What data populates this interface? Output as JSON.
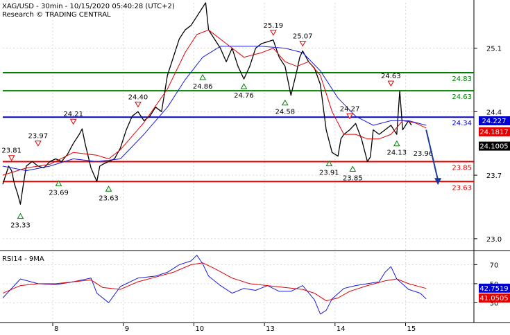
{
  "header": {
    "instrument_line": "XAG/USD - 30min - 10/15/2020 05:40:28 (UTC+2)",
    "research_line": "Research © TRADING CENTRAL"
  },
  "colors": {
    "price": "#000000",
    "ma_fast": "#e00000",
    "ma_slow": "#1c1cd8",
    "resistance_green": "#008000",
    "support_red": "#e00000",
    "pivot_blue": "#0000cc",
    "marker_red": "#e00000",
    "marker_green": "#008000",
    "projection_arrow": "#1a3a9c",
    "rsi_line": "#1c1cd8",
    "rsi_ma": "#e00000"
  },
  "chart_data": [
    {
      "type": "line",
      "panel": "price",
      "ylim": [
        22.9,
        25.6
      ],
      "y_ticks": [
        23.0,
        23.7,
        24.4,
        25.1
      ],
      "x_ticks": [
        "8",
        "9",
        "10",
        "13",
        "14",
        "15"
      ],
      "x_tick_positions": [
        17,
        41,
        65,
        89,
        113,
        137
      ],
      "x_range": [
        0,
        160
      ],
      "series": [
        {
          "role": "price",
          "x": [
            0,
            2,
            3,
            4,
            5,
            6,
            7,
            8,
            10,
            12,
            14,
            16,
            18,
            20,
            22,
            24,
            26,
            27,
            28,
            30,
            32,
            33,
            34,
            36,
            38,
            40,
            42,
            44,
            46,
            48,
            50,
            52,
            54,
            56,
            58,
            60,
            62,
            64,
            66,
            68,
            69,
            70,
            72,
            74,
            76,
            78,
            80,
            82,
            84,
            86,
            88,
            90,
            92,
            94,
            96,
            98,
            100,
            101,
            102,
            104,
            106,
            108,
            110,
            112,
            114,
            115,
            116,
            118,
            120,
            122,
            124,
            125,
            126,
            128,
            130,
            132,
            134,
            135,
            136,
            138,
            139
          ],
          "values": [
            23.6,
            23.8,
            23.75,
            23.6,
            23.5,
            23.38,
            23.6,
            23.8,
            23.85,
            23.8,
            23.78,
            23.85,
            23.88,
            23.85,
            23.93,
            24.05,
            24.15,
            24.21,
            24.05,
            23.78,
            23.63,
            23.8,
            23.82,
            23.85,
            23.88,
            24.0,
            24.2,
            24.35,
            24.4,
            24.3,
            24.35,
            24.45,
            24.4,
            24.8,
            25.0,
            25.2,
            25.3,
            25.35,
            25.45,
            25.55,
            25.6,
            25.3,
            25.2,
            25.1,
            24.95,
            25.1,
            24.9,
            24.76,
            24.9,
            25.1,
            25.15,
            25.17,
            25.19,
            25.0,
            24.9,
            24.58,
            24.85,
            25.0,
            25.07,
            24.95,
            24.88,
            24.7,
            24.2,
            23.95,
            23.91,
            24.1,
            24.15,
            24.2,
            24.27,
            24.1,
            23.85,
            23.9,
            24.2,
            24.15,
            24.2,
            24.25,
            24.15,
            24.63,
            24.2,
            24.3,
            24.25
          ],
          "name": ""
        },
        {
          "role": "fast_ma",
          "x": [
            0,
            8,
            16,
            24,
            32,
            36,
            40,
            48,
            56,
            62,
            66,
            70,
            76,
            82,
            88,
            92,
            96,
            100,
            104,
            108,
            112,
            116,
            120,
            124,
            128,
            132,
            136,
            140,
            144
          ],
          "values": [
            23.7,
            23.78,
            23.82,
            23.95,
            23.92,
            23.88,
            23.98,
            24.28,
            24.65,
            25.05,
            25.25,
            25.3,
            25.15,
            25.0,
            25.05,
            25.1,
            24.95,
            24.9,
            24.95,
            24.8,
            24.4,
            24.15,
            24.15,
            24.1,
            24.1,
            24.15,
            24.3,
            24.28,
            24.22
          ],
          "name": ""
        },
        {
          "role": "slow_ma",
          "x": [
            0,
            8,
            16,
            24,
            32,
            40,
            48,
            56,
            62,
            68,
            74,
            80,
            88,
            96,
            102,
            108,
            114,
            120,
            126,
            132,
            138,
            144
          ],
          "values": [
            23.8,
            23.75,
            23.8,
            23.88,
            23.85,
            23.88,
            24.15,
            24.45,
            24.75,
            25.0,
            25.12,
            25.12,
            25.12,
            25.1,
            25.05,
            24.85,
            24.55,
            24.35,
            24.25,
            24.3,
            24.3,
            24.25
          ]
        }
      ],
      "levels": [
        {
          "value": 24.83,
          "label": "24.83",
          "color": "#008000"
        },
        {
          "value": 24.63,
          "label": "24.63",
          "color": "#008000"
        },
        {
          "value": 24.34,
          "label": "24.34",
          "color": "#0000cc"
        },
        {
          "value": 23.85,
          "label": "23.85",
          "color": "#e00000"
        },
        {
          "value": 23.63,
          "label": "23.63",
          "color": "#e00000"
        }
      ],
      "markers": [
        {
          "x": 3,
          "value": 23.81,
          "label": "23.81",
          "dir": "down"
        },
        {
          "x": 12,
          "value": 23.97,
          "label": "23.97",
          "dir": "down"
        },
        {
          "x": 24,
          "value": 24.21,
          "label": "24.21",
          "dir": "down"
        },
        {
          "x": 46,
          "value": 24.4,
          "label": "24.40",
          "dir": "down"
        },
        {
          "x": 69,
          "value": 25.6,
          "label": "",
          "dir": "down"
        },
        {
          "x": 92,
          "value": 25.19,
          "label": "25.19",
          "dir": "down"
        },
        {
          "x": 102,
          "value": 25.07,
          "label": "25.07",
          "dir": "down"
        },
        {
          "x": 118,
          "value": 24.27,
          "label": "24.27",
          "dir": "down"
        },
        {
          "x": 132,
          "value": 24.63,
          "label": "24.63",
          "dir": "down"
        },
        {
          "x": 6,
          "value": 23.33,
          "label": "23.33",
          "dir": "up"
        },
        {
          "x": 19,
          "value": 23.69,
          "label": "23.69",
          "dir": "up"
        },
        {
          "x": 36,
          "value": 23.63,
          "label": "23.63",
          "dir": "up"
        },
        {
          "x": 68,
          "value": 24.86,
          "label": "24.86",
          "dir": "up"
        },
        {
          "x": 82,
          "value": 24.76,
          "label": "24.76",
          "dir": "up"
        },
        {
          "x": 96,
          "value": 24.58,
          "label": "24.58",
          "dir": "up"
        },
        {
          "x": 111,
          "value": 23.91,
          "label": "23.91",
          "dir": "up"
        },
        {
          "x": 119,
          "value": 23.85,
          "label": "23.85",
          "dir": "up"
        },
        {
          "x": 134,
          "value": 24.13,
          "label": "24.13",
          "dir": "up"
        },
        {
          "x": 143,
          "value": 23.96,
          "label": "23.96",
          "dir": "none"
        }
      ],
      "projection": {
        "from_x": 144,
        "from_value": 24.2,
        "to_x": 148,
        "to_value": 23.6
      },
      "price_badges": [
        {
          "value": 24.227,
          "label": "24.227",
          "bg": "#0000cc"
        },
        {
          "value": 24.1817,
          "label": "24.1817",
          "bg": "#e00000"
        },
        {
          "value": 24.1005,
          "label": "24.1005",
          "bg": "#000000"
        }
      ]
    },
    {
      "type": "line",
      "panel": "rsi",
      "title": "RSI14 - 9MA",
      "ylim": [
        12,
        82
      ],
      "y_ticks": [
        30,
        50,
        70
      ],
      "series": [
        {
          "role": "rsi",
          "x": [
            0,
            6,
            12,
            18,
            24,
            30,
            32,
            36,
            40,
            46,
            52,
            56,
            60,
            64,
            66,
            68,
            70,
            74,
            78,
            82,
            86,
            90,
            94,
            98,
            102,
            106,
            108,
            110,
            112,
            116,
            120,
            124,
            128,
            130,
            132,
            134,
            138,
            142,
            144
          ],
          "values": [
            35,
            55,
            50,
            49,
            52,
            56,
            40,
            30,
            47,
            56,
            58,
            62,
            70,
            74,
            80,
            71,
            58,
            48,
            40,
            45,
            43,
            48,
            42,
            42,
            48,
            33,
            18,
            22,
            34,
            45,
            48,
            50,
            52,
            62,
            68,
            55,
            44,
            40,
            34
          ],
          "name": ""
        },
        {
          "role": "rsi_ma",
          "x": [
            0,
            6,
            12,
            18,
            24,
            30,
            34,
            40,
            46,
            52,
            58,
            64,
            68,
            72,
            78,
            84,
            90,
            96,
            102,
            106,
            110,
            114,
            118,
            124,
            130,
            134,
            138,
            144
          ],
          "values": [
            40,
            48,
            50,
            50,
            52,
            54,
            46,
            44,
            52,
            57,
            62,
            70,
            72,
            66,
            56,
            50,
            48,
            46,
            44,
            40,
            32,
            35,
            42,
            48,
            53,
            55,
            50,
            45
          ]
        }
      ],
      "price_badges": [
        {
          "value": 42.7519,
          "label": "42.7519",
          "bg": "#0000cc"
        },
        {
          "value": 41.0505,
          "label": "41.0505",
          "bg": "#e00000"
        }
      ]
    }
  ]
}
